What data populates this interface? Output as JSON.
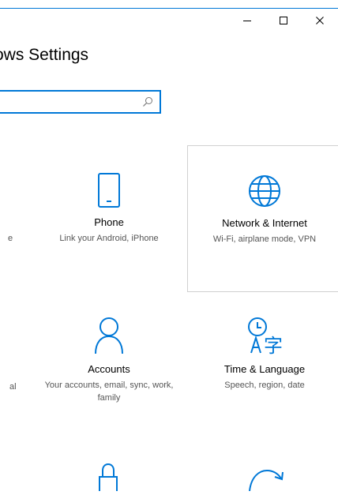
{
  "window": {
    "title_partial": "ows Settings",
    "accent": "#0078d7"
  },
  "search": {
    "value": "",
    "placeholder": "",
    "icon": "search-icon"
  },
  "tiles": [
    {
      "id": "phone",
      "title": "Phone",
      "desc": "Link your Android, iPhone",
      "icon": "phone-icon"
    },
    {
      "id": "network",
      "title": "Network & Internet",
      "desc": "Wi-Fi, airplane mode, VPN",
      "icon": "globe-icon"
    },
    {
      "id": "accounts",
      "title": "Accounts",
      "desc": "Your accounts, email, sync, work, family",
      "icon": "person-icon"
    },
    {
      "id": "time-language",
      "title": "Time & Language",
      "desc": "Speech, region, date",
      "icon": "time-language-icon"
    }
  ],
  "partial_left": [
    {
      "text": "e"
    },
    {
      "text": "al"
    }
  ]
}
